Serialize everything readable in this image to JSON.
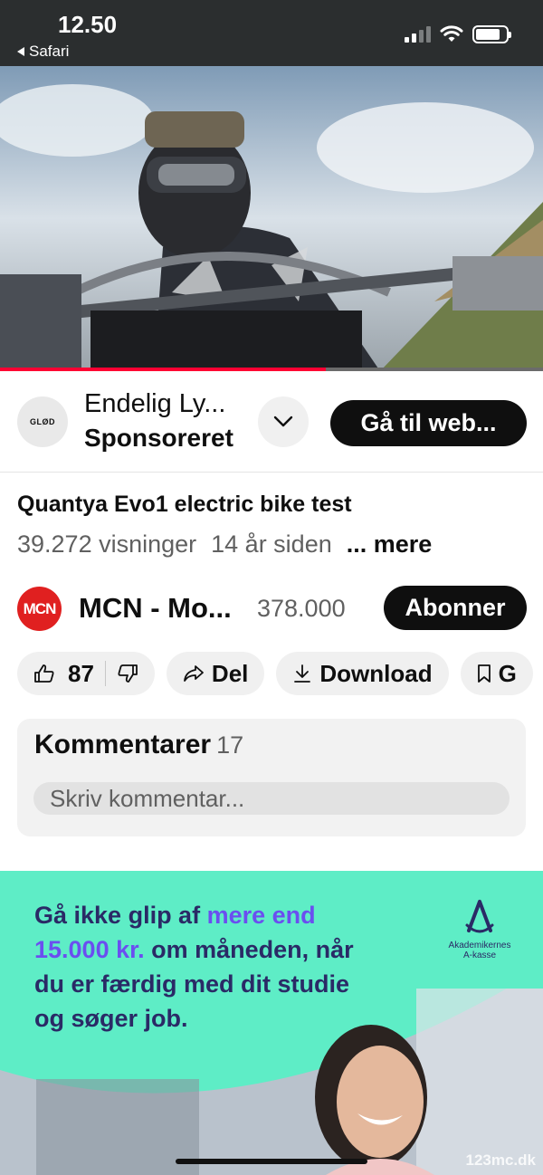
{
  "status": {
    "time": "12.50",
    "back_label": "Safari",
    "signal_icon": "cellular-signal-icon",
    "wifi_icon": "wifi-icon",
    "battery_icon": "battery-icon"
  },
  "video": {
    "progress_percent": 60,
    "progress_color": "#ff0033"
  },
  "ad": {
    "logo_text": "GLØD",
    "title": "Endelig Ly...",
    "subtitle": "Sponsoreret",
    "cta_label": "Gå til web..."
  },
  "video_info": {
    "title": "Quantya Evo1 electric bike test",
    "views": "39.272 visninger",
    "age": "14 år siden",
    "more_label": "... mere"
  },
  "channel": {
    "avatar_text": "MCN",
    "name": "MCN - Mo...",
    "subscribers": "378.000",
    "subscribe_label": "Abonner"
  },
  "actions": {
    "like_count": "87",
    "share_label": "Del",
    "download_label": "Download",
    "save_label": "G"
  },
  "comments": {
    "title": "Kommentarer",
    "count": "17",
    "placeholder": "Skriv kommentar..."
  },
  "banner": {
    "text_part1": "Gå ikke glip af ",
    "text_highlight": "mere end 15.000 kr.",
    "text_part2": " om måneden, når du er færdig med dit studie og søger job.",
    "logo_line1": "Akademikernes",
    "logo_line2": "A-kasse",
    "accent_color": "#5eedc6",
    "highlight_color": "#6b4ef0"
  },
  "watermark": "123mc.dk"
}
